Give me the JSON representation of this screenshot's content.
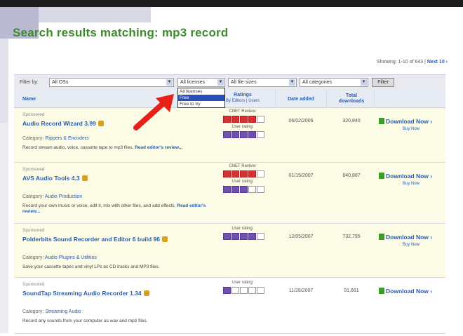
{
  "heading": "Search results matching: mp3 record",
  "showing": {
    "text": "Showing: 1-10 of 643",
    "sep": "|",
    "next": "Next 10 ›"
  },
  "filters": {
    "label": "Filter by:",
    "os": "All OSs",
    "licenses": "All licenses",
    "sizes": "All file sizes",
    "categories": "All categories",
    "button": "Filter",
    "license_options": [
      "All licenses",
      "Free",
      "Free to try"
    ],
    "license_highlighted": "Free"
  },
  "columns": {
    "name": "Name",
    "ratings": "Ratings",
    "ratings_sub": "By Editors | Users",
    "date": "Date added",
    "downloads_l1": "Total",
    "downloads_l2": "downloads"
  },
  "colors": {
    "accent_green": "#3c8c2a",
    "link_blue": "#2a5db0",
    "cnet_red": "#d83030",
    "user_purple": "#7050b0",
    "sponsored_bg": "#fbfbe6"
  },
  "results": [
    {
      "sponsored": "Sponsored",
      "title": "Audio Record Wizard 3.99",
      "category_label": "Category:",
      "category": "Rippers & Encoders",
      "desc": "Record stream audio, voice, cassette tape to mp3 files.",
      "desc_link": "Read editor's review...",
      "cnet_label": "CNET Review:",
      "cnet_rating": 4,
      "user_label": "User rating:",
      "user_rating": 4,
      "date": "06/02/2006",
      "downloads": "320,840",
      "download": "Download Now",
      "buy": "Buy Now"
    },
    {
      "sponsored": "Sponsored",
      "title": "AVS Audio Tools 4.3",
      "category_label": "Category:",
      "category": "Audio Production",
      "desc": "Record your own music or voice, edit it, mix with other files, and add effects.",
      "desc_link": "Read editor's review...",
      "cnet_label": "CNET Review:",
      "cnet_rating": 4,
      "user_label": "User rating:",
      "user_rating": 3,
      "date": "01/15/2007",
      "downloads": "840,887",
      "download": "Download Now",
      "buy": "Buy Now"
    },
    {
      "sponsored": "Sponsored",
      "title": "Polderbits Sound Recorder and Editor 6 build 96",
      "category_label": "Category:",
      "category": "Audio Plugins & Utilities",
      "desc": "Save your cassette tapes and vinyl LPs as CD tracks and MP3 files.",
      "user_label": "User rating:",
      "user_rating": 4,
      "date": "12/05/2007",
      "downloads": "732,795",
      "download": "Download Now",
      "buy": "Buy Now"
    },
    {
      "sponsored": "Sponsored",
      "title": "SoundTap Streaming Audio Recorder 1.34",
      "category_label": "Category:",
      "category": "Streaming Audio",
      "desc": "Record any sounds from your computer as wav and mp3 files.",
      "user_label": "User rating:",
      "user_rating": 1,
      "date": "11/28/2007",
      "downloads": "91,661",
      "download": "Download Now"
    }
  ]
}
